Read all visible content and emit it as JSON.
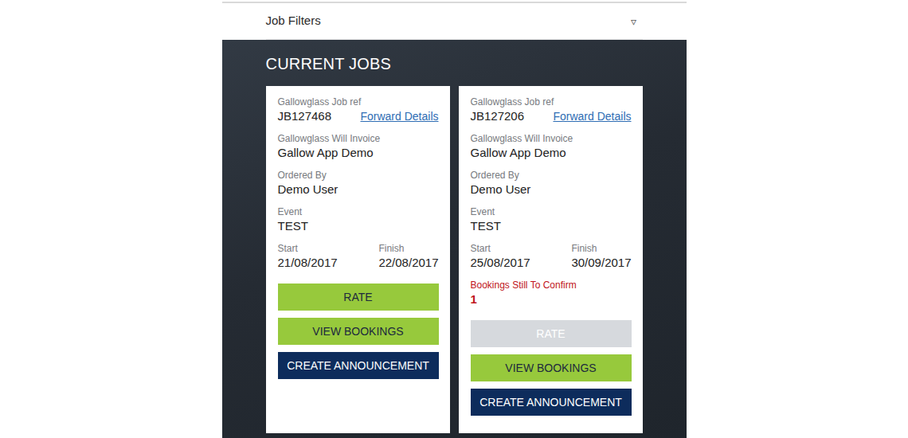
{
  "filters": {
    "label": "Job Filters",
    "toggle": "▿"
  },
  "section": {
    "title": "CURRENT JOBS"
  },
  "jobs": [
    {
      "ref": {
        "label": "Gallowglass Job ref",
        "value": "JB127468",
        "link": "Forward Details"
      },
      "fields": [
        {
          "label": "Gallowglass Will Invoice",
          "value": "Gallow App Demo"
        },
        {
          "label": "Ordered By",
          "value": "Demo User"
        },
        {
          "label": "Event",
          "value": "TEST"
        }
      ],
      "dates": [
        {
          "label": "Start",
          "value": "21/08/2017"
        },
        {
          "label": "Finish",
          "value": "22/08/2017"
        }
      ],
      "buttons": [
        {
          "label": "RATE",
          "kind": "green",
          "disabled": false
        },
        {
          "label": "VIEW BOOKINGS",
          "kind": "green",
          "disabled": false
        },
        {
          "label": "CREATE ANNOUNCEMENT",
          "kind": "navy",
          "disabled": false
        }
      ]
    },
    {
      "ref": {
        "label": "Gallowglass Job ref",
        "value": "JB127206",
        "link": "Forward Details"
      },
      "fields": [
        {
          "label": "Gallowglass Will Invoice",
          "value": "Gallow App Demo"
        },
        {
          "label": "Ordered By",
          "value": "Demo User"
        },
        {
          "label": "Event",
          "value": "TEST"
        }
      ],
      "dates": [
        {
          "label": "Start",
          "value": "25/08/2017"
        },
        {
          "label": "Finish",
          "value": "30/09/2017"
        }
      ],
      "pending": {
        "label": "Bookings Still To Confirm",
        "value": "1"
      },
      "buttons": [
        {
          "label": "RATE",
          "kind": "green",
          "disabled": true
        },
        {
          "label": "VIEW BOOKINGS",
          "kind": "green",
          "disabled": false
        },
        {
          "label": "CREATE ANNOUNCEMENT",
          "kind": "navy",
          "disabled": false
        }
      ]
    }
  ]
}
